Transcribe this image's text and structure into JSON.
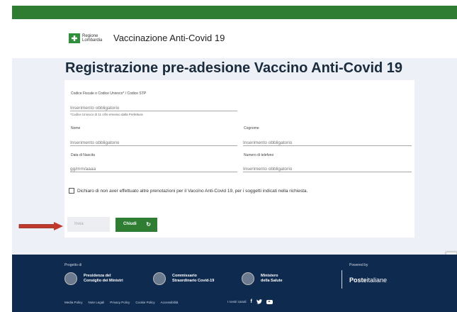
{
  "header": {
    "logo_line1": "Regione",
    "logo_line2": "Lombardia",
    "app_title": "Vaccinazione Anti-Covid 19"
  },
  "page": {
    "title": "Registrazione pre-adesione Vaccino Anti-Covid 19"
  },
  "form": {
    "codice_label": "Codice Fiscale o Codice Univoco* / Codice STP",
    "codice_placeholder": "Inserimento obbligatorio",
    "codice_hint": "*Codice Univoco di 11 cifre emesso dalla Prefettura",
    "nome_label": "Nome",
    "nome_placeholder": "Inserimento obbligatorio",
    "cognome_label": "Cognome",
    "cognome_placeholder": "Inserimento obbligatorio",
    "data_label": "Data di Nascita",
    "data_placeholder": "gg/mm/aaaa",
    "telefono_label": "Numero di telefono",
    "telefono_placeholder": "Inserimento obbligatorio",
    "checkbox_label": "Dichiaro di non aver effettuato altre prenotazioni per il Vaccino Anti-Covid 19, per i soggetti indicati nella richiesta.",
    "invia_label": "Invia",
    "chiudi_label": "Chiudi"
  },
  "footer": {
    "progetto_label": "Progetto di",
    "orgs": [
      {
        "line1": "Presidenza del",
        "line2": "Consiglio dei Ministri"
      },
      {
        "line1": "Commissario",
        "line2": "Straordinario Covid-19"
      },
      {
        "line1": "Ministero",
        "line2": "della Salute"
      }
    ],
    "powered_label": "Powered by",
    "poste_bold": "Poste",
    "poste_light": "italiane",
    "links": [
      "Media Policy",
      "Note Legali",
      "Privacy Policy",
      "Cookie Policy",
      "Accessibilità"
    ],
    "channels_label": "I nostri canali"
  },
  "colors": {
    "brand_green": "#2f7d32",
    "footer_navy": "#0e2a4f",
    "arrow_red": "#c0392b"
  }
}
